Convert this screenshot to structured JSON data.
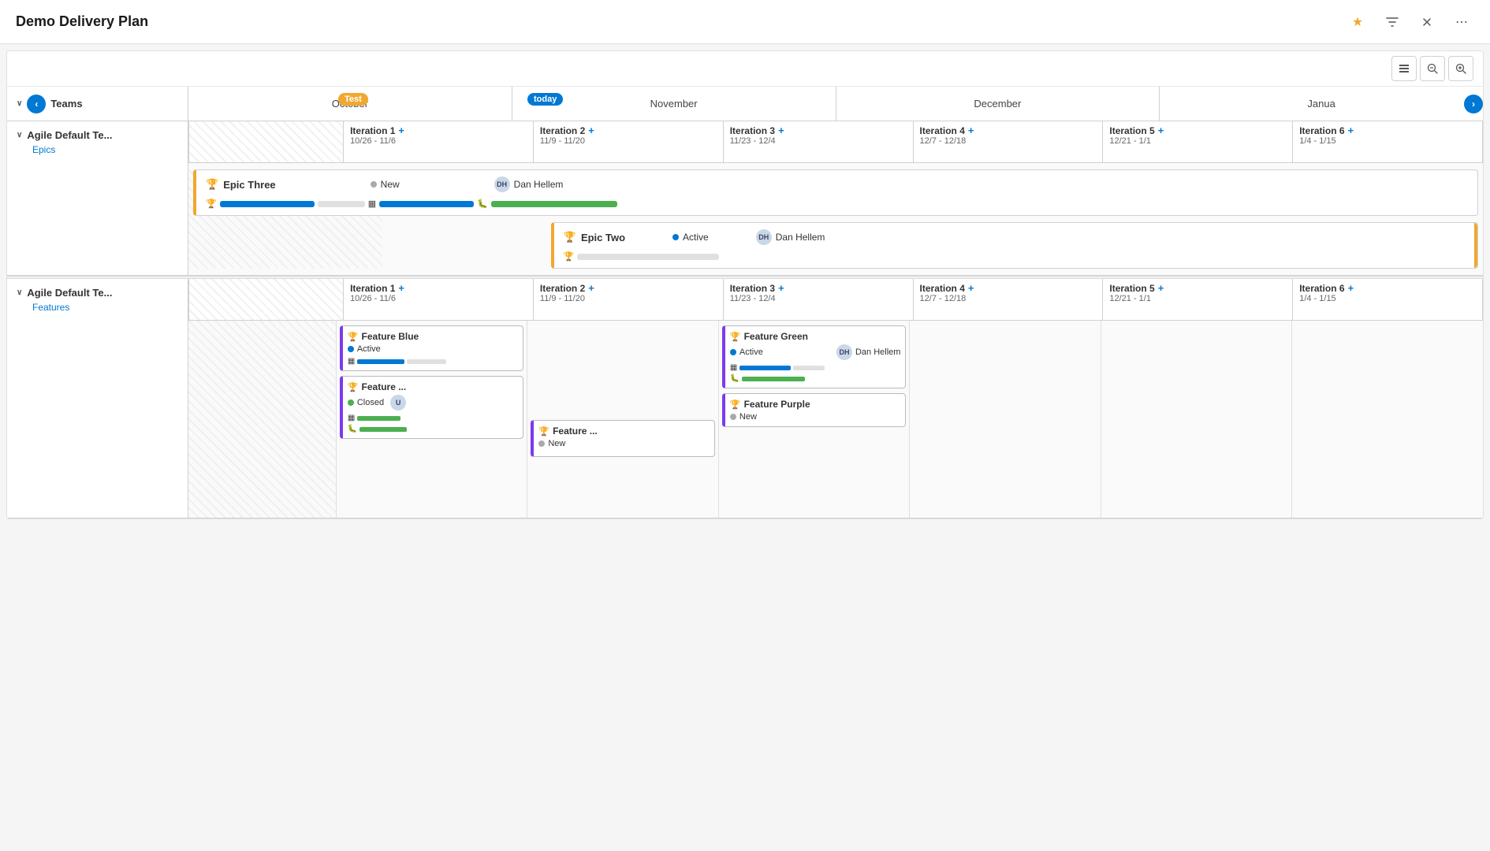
{
  "app": {
    "title": "Demo Delivery Plan"
  },
  "toolbar": {
    "collapse_label": "⊟",
    "zoom_out_label": "🔍",
    "zoom_in_label": "🔍"
  },
  "header": {
    "teams_label": "Teams",
    "nav_back": "‹",
    "nav_forward": "›",
    "months": [
      "October",
      "November",
      "December",
      "Janua"
    ],
    "marker_test": "Test",
    "marker_today": "today"
  },
  "team1": {
    "name": "Agile Default Te...",
    "sub_label": "Epics",
    "iterations": [
      {
        "name": "Iteration 1",
        "dates": "10/26 - 11/6"
      },
      {
        "name": "Iteration 2",
        "dates": "11/9 - 11/20"
      },
      {
        "name": "Iteration 3",
        "dates": "11/23 - 12/4"
      },
      {
        "name": "Iteration 4",
        "dates": "12/7 - 12/18"
      },
      {
        "name": "Iteration 5",
        "dates": "12/21 - 1/1"
      },
      {
        "name": "Iteration 6",
        "dates": "1/4 - 1/15"
      }
    ],
    "epics": [
      {
        "name": "Epic Three",
        "status": "New",
        "assignee": "Dan Hellem",
        "assignee_initials": "DH"
      },
      {
        "name": "Epic Two",
        "status": "Active",
        "assignee": "Dan Hellem",
        "assignee_initials": "DH"
      }
    ]
  },
  "team2": {
    "name": "Agile Default Te...",
    "sub_label": "Features",
    "iterations": [
      {
        "name": "Iteration 1",
        "dates": "10/26 - 11/6"
      },
      {
        "name": "Iteration 2",
        "dates": "11/9 - 11/20"
      },
      {
        "name": "Iteration 3",
        "dates": "11/23 - 12/4"
      },
      {
        "name": "Iteration 4",
        "dates": "12/7 - 12/18"
      },
      {
        "name": "Iteration 5",
        "dates": "12/21 - 1/1"
      },
      {
        "name": "Iteration 6",
        "dates": "1/4 - 1/15"
      }
    ],
    "features": [
      {
        "id": "feature-blue",
        "name": "Feature Blue",
        "status": "Active",
        "status_type": "active",
        "assignee": "",
        "assignee_initials": "",
        "col": 1,
        "col_span": 1,
        "accent_color": "#7c3aed",
        "bar1_width": 60,
        "bar2_width": 0
      },
      {
        "id": "feature-green",
        "name": "Feature Green",
        "status": "Active",
        "status_type": "active",
        "assignee": "Dan Hellem",
        "assignee_initials": "DH",
        "col": 3,
        "accent_color": "#7c3aed",
        "bar1_width": 65,
        "bar2_width": 80
      },
      {
        "id": "feature-blue2",
        "name": "Feature ...",
        "status": "Closed",
        "status_type": "closed",
        "assignee": "",
        "assignee_initials": "U",
        "col": 1,
        "accent_color": "#7c3aed",
        "bar1_width": 55,
        "bar2_width": 60
      },
      {
        "id": "feature-blue3",
        "name": "Feature ...",
        "status": "New",
        "status_type": "new",
        "assignee": "",
        "assignee_initials": "",
        "col": 2,
        "accent_color": "#7c3aed",
        "bar1_width": 0,
        "bar2_width": 0
      },
      {
        "id": "feature-purple",
        "name": "Feature Purple",
        "status": "New",
        "status_type": "new",
        "assignee": "",
        "assignee_initials": "",
        "col": 3,
        "accent_color": "#7c3aed",
        "bar1_width": 0,
        "bar2_width": 0
      }
    ]
  },
  "icons": {
    "star": "★",
    "filter": "⧖",
    "collapse": "⤡",
    "more": "⋯",
    "trophy": "🏆",
    "bug": "🐛",
    "chevron_down": "∨",
    "chevron_right": "›",
    "plus": "+",
    "collapse_rows": "☰"
  },
  "colors": {
    "blue": "#0078d4",
    "orange": "#f0a830",
    "purple": "#7c3aed",
    "green": "#4CAF50",
    "gray": "#aaaaaa"
  }
}
